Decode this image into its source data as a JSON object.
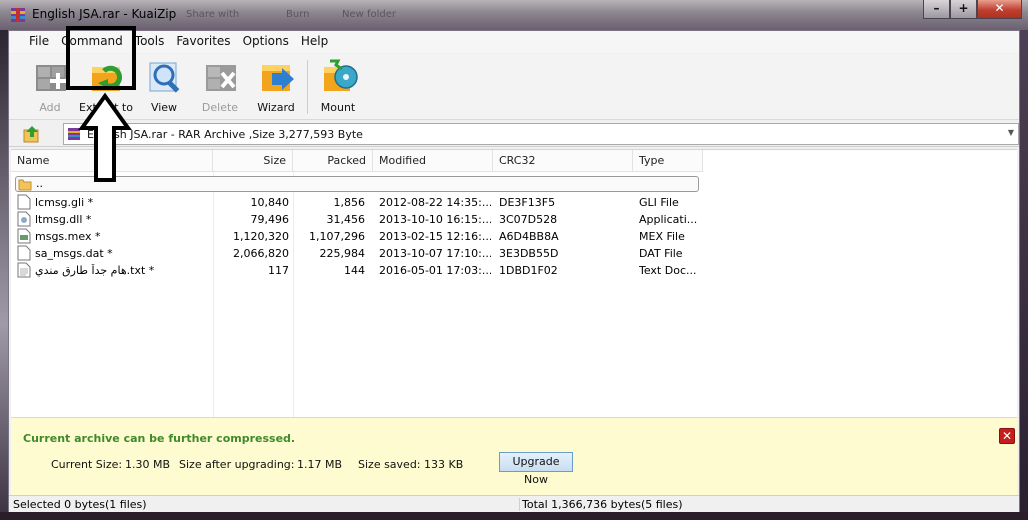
{
  "window": {
    "title": "English JSA.rar - KuaiZip",
    "background_hints": [
      "Share with",
      "Burn",
      "New folder"
    ],
    "controls": {
      "minimize": "–",
      "maximize": "+",
      "close": "✕"
    }
  },
  "menu": [
    "File",
    "Command",
    "Tools",
    "Favorites",
    "Options",
    "Help"
  ],
  "toolbar": {
    "add": "Add",
    "extract": "Extract to",
    "view": "View",
    "delete": "Delete",
    "wizard": "Wizard",
    "mount": "Mount"
  },
  "address": {
    "path": "English JSA.rar - RAR Archive ,Size 3,277,593 Byte"
  },
  "columns": [
    "Name",
    "Size",
    "Packed",
    "Modified",
    "CRC32",
    "Type"
  ],
  "parent_dir": "..",
  "files": [
    {
      "name": "lcmsg.gli *",
      "size": "10,840",
      "packed": "1,856",
      "modified": "2012-08-22   14:35:...",
      "crc": "DE3F13F5",
      "type": "GLI File",
      "icon": "generic-file-icon"
    },
    {
      "name": "ltmsg.dll *",
      "size": "79,496",
      "packed": "31,456",
      "modified": "2013-10-10   16:15:...",
      "crc": "3C07D528",
      "type": "Applicati...",
      "icon": "dll-file-icon"
    },
    {
      "name": "msgs.mex *",
      "size": "1,120,320",
      "packed": "1,107,296",
      "modified": "2013-02-15   12:16:...",
      "crc": "A6D4BB8A",
      "type": "MEX File",
      "icon": "mex-file-icon"
    },
    {
      "name": "sa_msgs.dat *",
      "size": "2,066,820",
      "packed": "225,984",
      "modified": "2013-10-07   17:10:...",
      "crc": "3E3DB55D",
      "type": "DAT File",
      "icon": "generic-file-icon"
    },
    {
      "name": "هام جداً طارق مندي.txt *",
      "size": "117",
      "packed": "144",
      "modified": "2016-05-01   17:03:...",
      "crc": "1DBD1F02",
      "type": "Text Doc...",
      "icon": "text-file-icon"
    }
  ],
  "info": {
    "title": "Current archive can be further compressed.",
    "current_size_label": "Current Size:",
    "current_size": "1.30 MB",
    "after_label": "Size after upgrading:",
    "after_size": "1.17 MB",
    "saved_label": "Size saved:",
    "saved_size": "133 KB",
    "upgrade_button": "Upgrade Now"
  },
  "status": {
    "selected": "Selected 0 bytes(1 files)",
    "total": "Total 1,366,736 bytes(5 files)"
  },
  "colors": {
    "info_title": "#3e8a2c",
    "info_bg": "#fefbd0",
    "close_red": "#c51e1e"
  }
}
